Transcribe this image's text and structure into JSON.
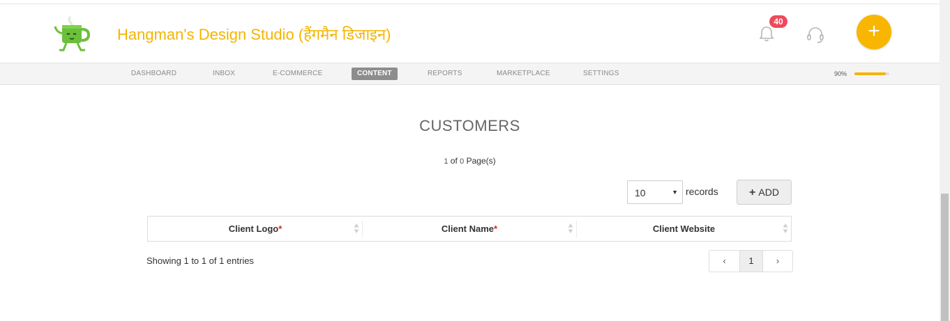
{
  "header": {
    "brand": "Hangman's Design Studio (हैंगमैन डिजाइन)",
    "notification_count": "40"
  },
  "nav": {
    "items": [
      "DASHBOARD",
      "INBOX",
      "E-COMMERCE",
      "CONTENT",
      "REPORTS",
      "MARKETPLACE",
      "SETTINGS"
    ],
    "active": "CONTENT"
  },
  "progress": {
    "label": "90%",
    "value": 0.9
  },
  "main": {
    "title": "CUSTOMERS",
    "page_current": "1",
    "page_of": "of",
    "page_total": "0",
    "page_suffix": "Page(s)",
    "records_select_value": "10",
    "records_label": "records",
    "add_label": "ADD",
    "columns": [
      {
        "label": "Client Logo",
        "required": "*"
      },
      {
        "label": "Client Name",
        "required": "*"
      },
      {
        "label": "Client Website",
        "required": ""
      }
    ],
    "showing": "Showing 1 to 1 of 1 entries",
    "pagination": {
      "prev": "‹",
      "current": "1",
      "next": "›"
    }
  },
  "colors": {
    "accent": "#f5b400",
    "badge": "#ee4a5b",
    "required": "#e02020"
  },
  "icons": [
    "tea-cup-logo-icon",
    "bell-icon",
    "headset-icon",
    "plus-icon",
    "sort-icon",
    "chevron-left-icon",
    "chevron-right-icon"
  ]
}
